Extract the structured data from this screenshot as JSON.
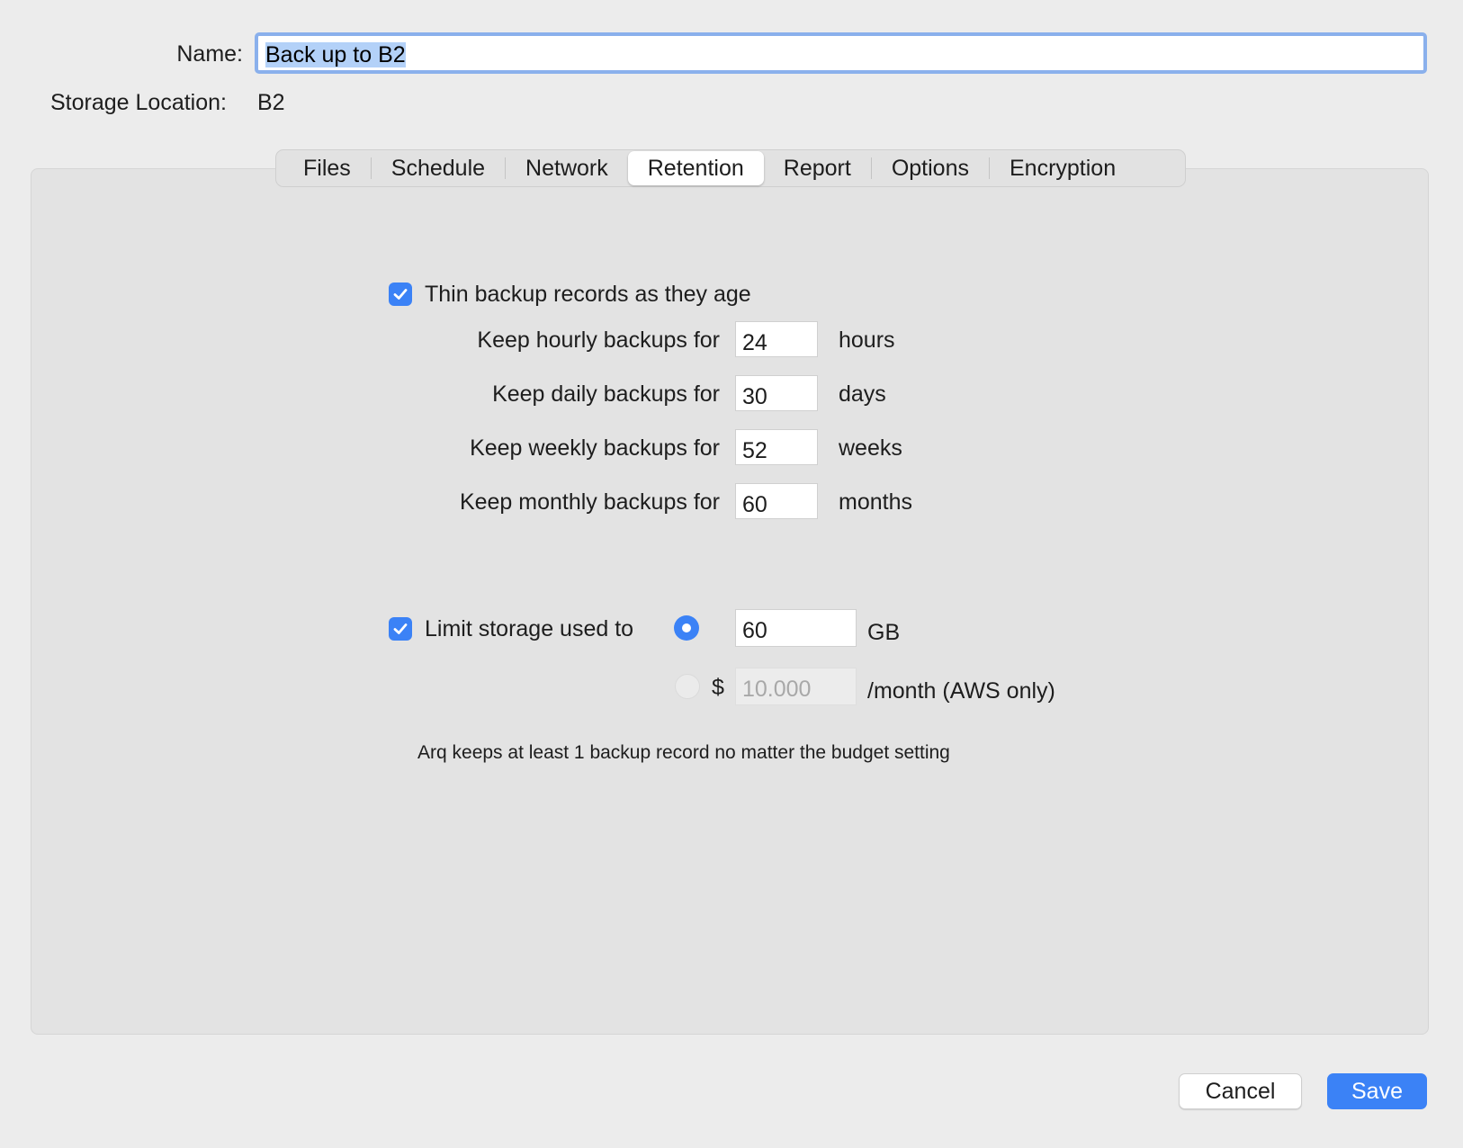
{
  "header": {
    "name_label": "Name:",
    "name_value": "Back up to B2",
    "storage_label": "Storage Location:",
    "storage_value": "B2"
  },
  "tabs": [
    {
      "label": "Files",
      "active": false
    },
    {
      "label": "Schedule",
      "active": false
    },
    {
      "label": "Network",
      "active": false
    },
    {
      "label": "Retention",
      "active": true
    },
    {
      "label": "Report",
      "active": false
    },
    {
      "label": "Options",
      "active": false
    },
    {
      "label": "Encryption",
      "active": false
    }
  ],
  "retention": {
    "thin": {
      "checked": true,
      "label": "Thin backup records as they age"
    },
    "rows": [
      {
        "label": "Keep hourly backups for",
        "value": "24",
        "unit": "hours"
      },
      {
        "label": "Keep daily backups for",
        "value": "30",
        "unit": "days"
      },
      {
        "label": "Keep weekly backups for",
        "value": "52",
        "unit": "weeks"
      },
      {
        "label": "Keep monthly backups for",
        "value": "60",
        "unit": "months"
      }
    ],
    "limit": {
      "checked": true,
      "label": "Limit storage used to",
      "gb_selected": true,
      "gb_value": "60",
      "gb_unit": "GB",
      "dollar_symbol": "$",
      "dollar_placeholder": "10.000",
      "dollar_unit": "/month (AWS only)"
    },
    "note": "Arq keeps at least 1 backup record no matter the budget setting"
  },
  "footer": {
    "cancel_label": "Cancel",
    "save_label": "Save"
  },
  "colors": {
    "accent": "#3b82f6",
    "name_focus_ring": "#8ab0ec",
    "selection": "#b3d1f8"
  }
}
